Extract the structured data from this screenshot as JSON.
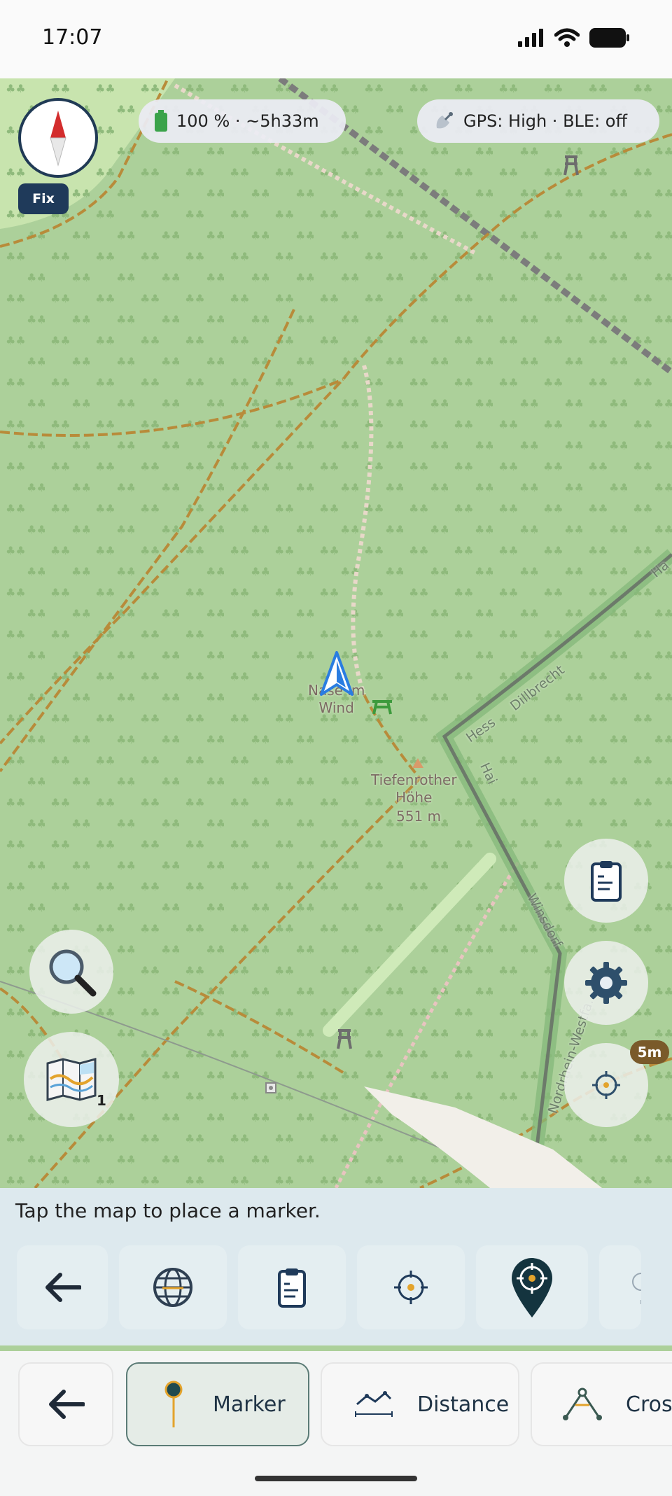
{
  "status": {
    "time": "17:07"
  },
  "battery_pill": {
    "text": "100 % · ~5h33m",
    "icon": "battery-icon"
  },
  "gps_pill": {
    "text": "GPS: High · BLE: off",
    "icon": "satellite-icon"
  },
  "compass": {
    "fix_label": "Fix"
  },
  "map": {
    "labels": {
      "place": "Nase im\nWind",
      "peak_name": "Tiefenrother\nHöhe",
      "peak_elevation": "551 m",
      "street_hess": "Hess",
      "street_dillbrecht": "Dillbrecht",
      "street_hai": "Hai",
      "street_winsdorf": "Winsdorf",
      "street_nrw": "Nordrhein-Westfa...",
      "street_edge": "Ha"
    },
    "scale_badge": "5m",
    "layer_count": "1"
  },
  "hint": {
    "text": "Tap the map to place a marker."
  },
  "tools": [
    {
      "name": "back",
      "icon": "arrow-left-icon"
    },
    {
      "name": "globe",
      "icon": "globe-icon"
    },
    {
      "name": "clipboard",
      "icon": "clipboard-icon"
    },
    {
      "name": "crosshair",
      "icon": "crosshair-icon"
    },
    {
      "name": "marker-target",
      "icon": "map-pin-target-icon"
    }
  ],
  "modes": [
    {
      "label": "",
      "icon": "arrow-left-icon"
    },
    {
      "label": "Marker",
      "icon": "marker-pin-icon",
      "active": true
    },
    {
      "label": "Distance",
      "icon": "distance-icon"
    },
    {
      "label": "Cross",
      "icon": "cross-bearing-icon"
    }
  ],
  "colors": {
    "forest": "#acd09a",
    "track": "#b88b3a",
    "accent_navy": "#1f3a5a",
    "hint_panel": "#dde9ee"
  }
}
